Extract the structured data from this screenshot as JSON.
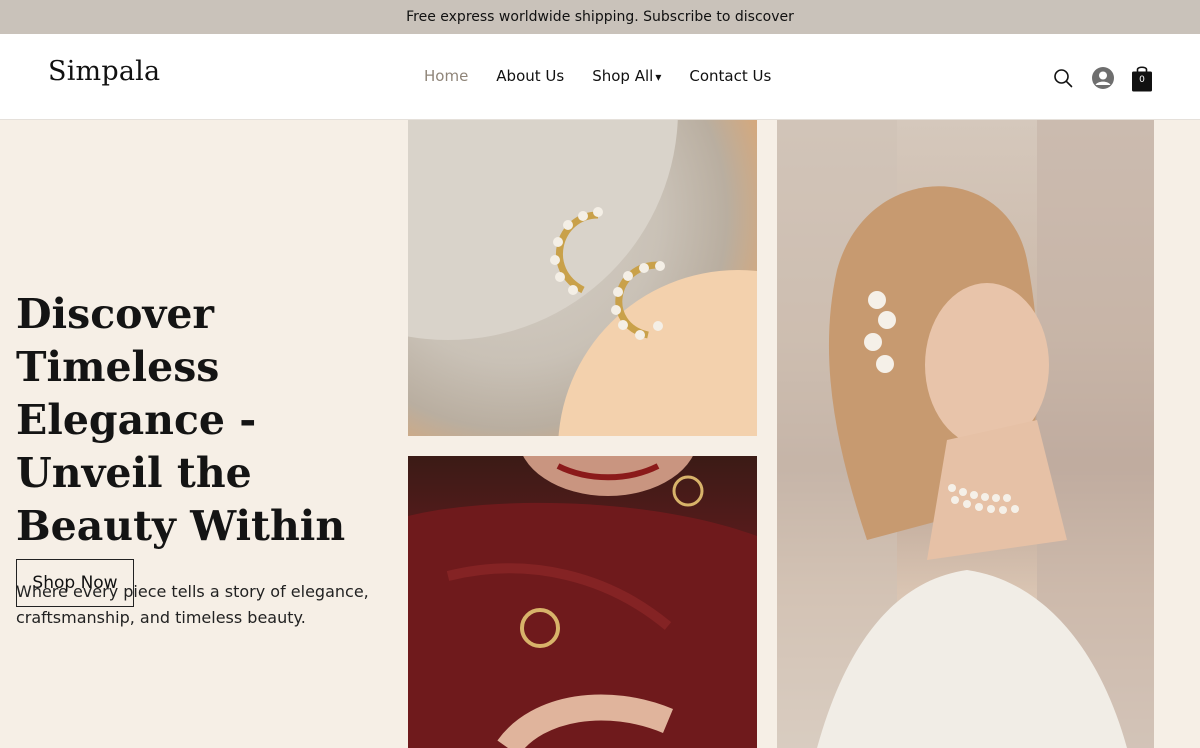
{
  "announcement": {
    "text": "Free express worldwide shipping. Subscribe to discover"
  },
  "header": {
    "logo": "Simpala",
    "nav": [
      {
        "label": "Home",
        "active": true
      },
      {
        "label": "About Us",
        "active": false
      },
      {
        "label": "Shop All",
        "has_dropdown": true,
        "caret": "▾"
      },
      {
        "label": "Contact Us",
        "active": false
      }
    ],
    "icons": {
      "search": "search-icon",
      "account": "user-account-icon",
      "cart": "shopping-bag-icon"
    },
    "cart_count": "0"
  },
  "hero": {
    "title": "Discover Timeless Elegance - Unveil the Beauty Within",
    "subtitle": "Where every piece tells a story of elegance, craftsmanship, and timeless beauty.",
    "cta": "Shop Now"
  },
  "gallery": [
    {
      "name": "pearl-earrings-image",
      "desc": "gold pearl spiral earrings on stone"
    },
    {
      "name": "red-velvet-model-image",
      "desc": "woman in red velvet with gold jewelry"
    },
    {
      "name": "pearl-choker-model-image",
      "desc": "woman with pearl hair clip and pearl choker"
    }
  ],
  "colors": {
    "accent": "#8f8579",
    "bar": "#c9c2ba",
    "background": "#f6efe6"
  }
}
